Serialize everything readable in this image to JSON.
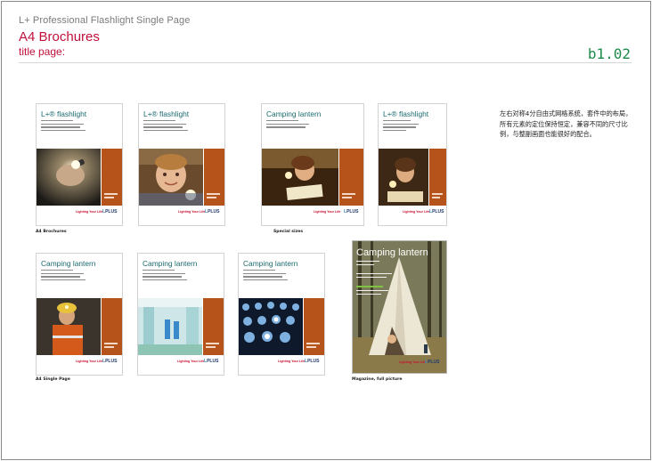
{
  "header": {
    "subtitle": "L+ Professional Flashlight Single Page",
    "title": "A4 Brochures",
    "page_label": "title page:",
    "code": "b1.02"
  },
  "note": "左右对称4分自由式网格系统，套件中的布局，所有元素的定位保持恒定，兼容不同的尺寸比例，与整副画面也能很好的配合。",
  "captions": {
    "a4_brochures": "A4 Brochures",
    "special_sizes": "Special sizes",
    "a4_single_page": "A4 Single Page",
    "magazine": "Magazine, full picture"
  },
  "brand": {
    "slogan": "Lighting Your Life",
    "logo_prefix": "L",
    "logo_text": "PLUS",
    "accent": "#b5531a",
    "heading_color": "#c0103a",
    "code_color": "#1f8a4c"
  },
  "cards": [
    {
      "title": "L+® flashlight"
    },
    {
      "title": "L+® flashlight"
    },
    {
      "title": "Camping lantern"
    },
    {
      "title": "L+® flashlight"
    },
    {
      "title": "Camping lantern"
    },
    {
      "title": "Camping lantern"
    },
    {
      "title": "Camping lantern"
    }
  ],
  "magazine": {
    "title": "Camping lantern"
  }
}
